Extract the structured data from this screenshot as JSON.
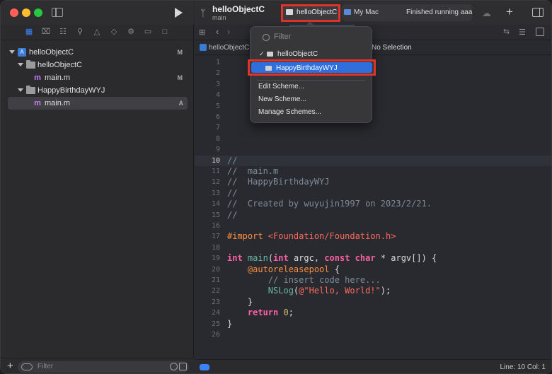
{
  "sidebar": {
    "tree": [
      {
        "label": "helloObjectC",
        "badge": "M"
      },
      {
        "label": "helloObjectC",
        "badge": ""
      },
      {
        "label": "main.m",
        "badge": "M"
      },
      {
        "label": "HappyBirthdayWYJ",
        "badge": ""
      },
      {
        "label": "main.m",
        "badge": "A"
      }
    ],
    "filter_placeholder": "Filter",
    "add_glyph": "+"
  },
  "toolbar": {
    "project_title": "helloObjectC",
    "branch": "main",
    "scheme": "helloObjectC",
    "destination": "My Mac",
    "status": "Finished running aaa"
  },
  "jump_bar": {
    "path": "helloObjectC",
    "selection": "No Selection"
  },
  "popover": {
    "filter_placeholder": "Filter",
    "schemes": [
      "helloObjectC",
      "HappyBirthdayWYJ"
    ],
    "checked_scheme": "helloObjectC",
    "highlighted_scheme": "HappyBirthdayWYJ",
    "actions": [
      "Edit Scheme...",
      "New Scheme...",
      "Manage Schemes..."
    ]
  },
  "editor": {
    "line_numbers": [
      "1",
      "2",
      "3",
      "4",
      "5",
      "6",
      "7",
      "8",
      "9",
      "10",
      "11",
      "12",
      "13",
      "14",
      "15",
      "16",
      "17",
      "18",
      "19",
      "20",
      "21",
      "22",
      "23",
      "24",
      "25",
      "26"
    ],
    "current_line": 10,
    "code": {
      "l10": "//",
      "l11": "//  main.m",
      "l12": "//  HappyBirthdayWYJ",
      "l13": "//",
      "l14": "//  Created by wuyujin1997 on 2023/2/21.",
      "l15": "//",
      "l17_kw": "#import",
      "l17_path": " <Foundation/Foundation.h>",
      "l19_int": "int",
      "l19_main": " main",
      "l19_paren": "(",
      "l19_int2": "int",
      "l19_argc": " argc, ",
      "l19_const": "const",
      "l19_sp": " ",
      "l19_char": "char",
      "l19_rest": " * argv[]) {",
      "l20_at": "    @autoreleasepool",
      "l20_rest": " {",
      "l21": "        // insert code here...",
      "l22_fn": "        NSLog",
      "l22_open": "(",
      "l22_str": "@\"Hello, World!\"",
      "l22_close": ");",
      "l23": "    }",
      "l24_kw": "    return",
      "l24_sp": " ",
      "l24_num": "0",
      "l24_end": ";",
      "l25": "}"
    }
  },
  "status_bar": {
    "line_col": "Line: 10  Col: 1"
  }
}
